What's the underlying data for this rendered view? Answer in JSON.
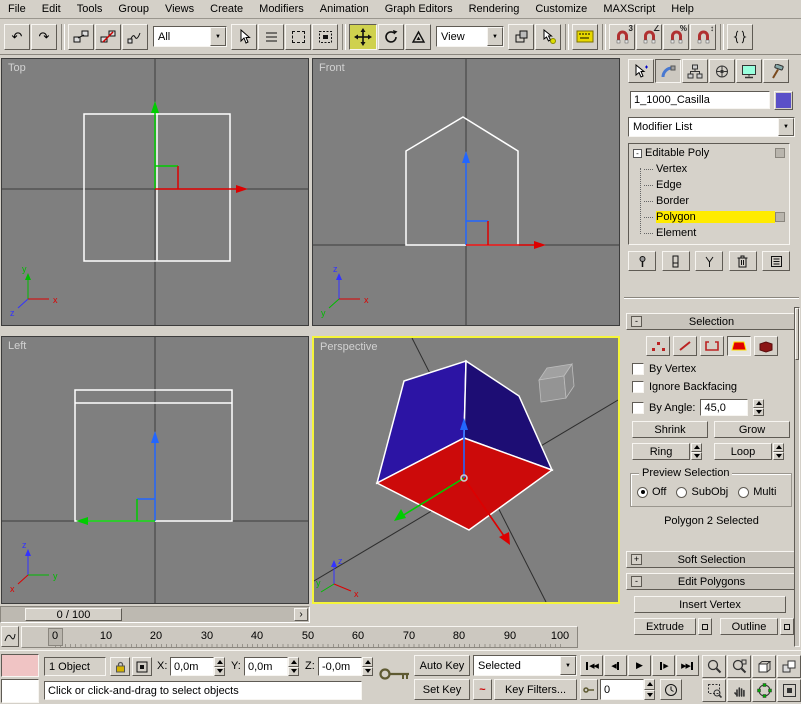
{
  "menu": {
    "items": [
      "File",
      "Edit",
      "Tools",
      "Group",
      "Views",
      "Create",
      "Modifiers",
      "Animation",
      "Graph Editors",
      "Rendering",
      "Customize",
      "MAXScript",
      "Help"
    ]
  },
  "toolbar": {
    "selection_filter_value": "All",
    "coordsys_value": "View"
  },
  "viewports": {
    "top": "Top",
    "front": "Front",
    "left": "Left",
    "perspective": "Perspective"
  },
  "axis": {
    "x": "x",
    "y": "y",
    "z": "z"
  },
  "time_slider": {
    "handle": "0 / 100",
    "next": "›"
  },
  "track_bar": {
    "ticks": [
      "0",
      "10",
      "20",
      "30",
      "40",
      "50",
      "60",
      "70",
      "80",
      "90",
      "100"
    ]
  },
  "command_panel": {
    "object_name": "1_1000_Casilla",
    "modifier_list_label": "Modifier List",
    "stack": {
      "root": "Editable Poly",
      "children": [
        "Vertex",
        "Edge",
        "Border",
        "Polygon",
        "Element"
      ]
    },
    "selection": {
      "title": "Selection",
      "by_vertex": "By Vertex",
      "ignore_backfacing": "Ignore Backfacing",
      "by_angle": "By Angle:",
      "by_angle_value": "45,0",
      "shrink": "Shrink",
      "grow": "Grow",
      "ring": "Ring",
      "loop": "Loop",
      "preview_title": "Preview Selection",
      "off": "Off",
      "subobj": "SubObj",
      "multi": "Multi",
      "status": "Polygon 2 Selected"
    },
    "rollouts": {
      "soft_selection": "Soft Selection",
      "edit_polygons": "Edit Polygons"
    },
    "edit_polygons": {
      "insert_vertex": "Insert Vertex",
      "extrude": "Extrude",
      "outline": "Outline"
    }
  },
  "status_bar": {
    "object_count": "1 Object",
    "x_label": "X:",
    "x_value": "0,0m",
    "y_label": "Y:",
    "y_value": "0,0m",
    "z_label": "Z:",
    "z_value": "-0,0m",
    "prompt": "Click or click-and-drag to select objects",
    "auto_key": "Auto Key",
    "set_key": "Set Key",
    "key_mode_value": "Selected",
    "key_filters": "Key Filters...",
    "frame_value": "0"
  },
  "icons": {
    "undo": "↶",
    "redo": "↷",
    "combo_arrow": "▼",
    "collapse": "-",
    "minus": "-",
    "plus": "+",
    "snap3": "3",
    "snap_angle": "∠",
    "snap_percent": "%",
    "snap_spinner": "↕",
    "curve": "~",
    "rew": "◀◀",
    "prev": "◀",
    "play": "▶",
    "next": "▶",
    "ffw": "▶▶"
  },
  "colors": {
    "selected_face_red": "#cc0a0a",
    "face_blue": "#2c14a4",
    "face_blue_dark": "#1d0d74",
    "object_color_swatch": "#5a50c8",
    "stack_selection": "#ffeb00",
    "active_viewport_border": "#f5f53a"
  }
}
